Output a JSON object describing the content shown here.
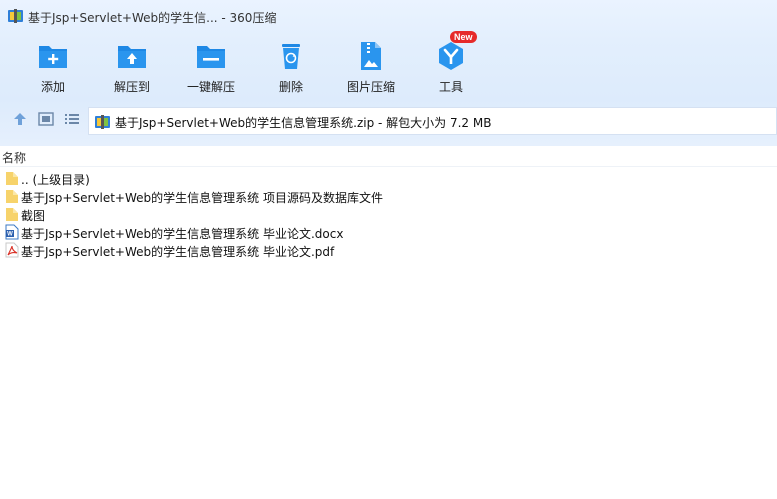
{
  "window": {
    "title": "基于Jsp+Servlet+Web的学生信... - 360压缩"
  },
  "toolbar": [
    {
      "label": "添加",
      "icon": "add-icon"
    },
    {
      "label": "解压到",
      "icon": "extract-to-icon"
    },
    {
      "label": "一键解压",
      "icon": "one-click-extract-icon"
    },
    {
      "label": "删除",
      "icon": "delete-icon"
    },
    {
      "label": "图片压缩",
      "icon": "image-compress-icon"
    },
    {
      "label": "工具",
      "icon": "tools-icon",
      "badge": "New"
    }
  ],
  "address": {
    "text": "基于Jsp+Servlet+Web的学生信息管理系统.zip - 解包大小为 7.2 MB"
  },
  "list": {
    "header": "名称",
    "items": [
      {
        "name": ".. (上级目录)",
        "type": "folder"
      },
      {
        "name": "基于Jsp+Servlet+Web的学生信息管理系统 项目源码及数据库文件",
        "type": "folder"
      },
      {
        "name": "截图",
        "type": "folder"
      },
      {
        "name": "基于Jsp+Servlet+Web的学生信息管理系统 毕业论文.docx",
        "type": "docx"
      },
      {
        "name": "基于Jsp+Servlet+Web的学生信息管理系统 毕业论文.pdf",
        "type": "pdf"
      }
    ]
  },
  "colors": {
    "accent": "#1e88e5",
    "toolbar_bg": "#e3effd",
    "folder": "#f7d36b",
    "pdf": "#d93025"
  }
}
